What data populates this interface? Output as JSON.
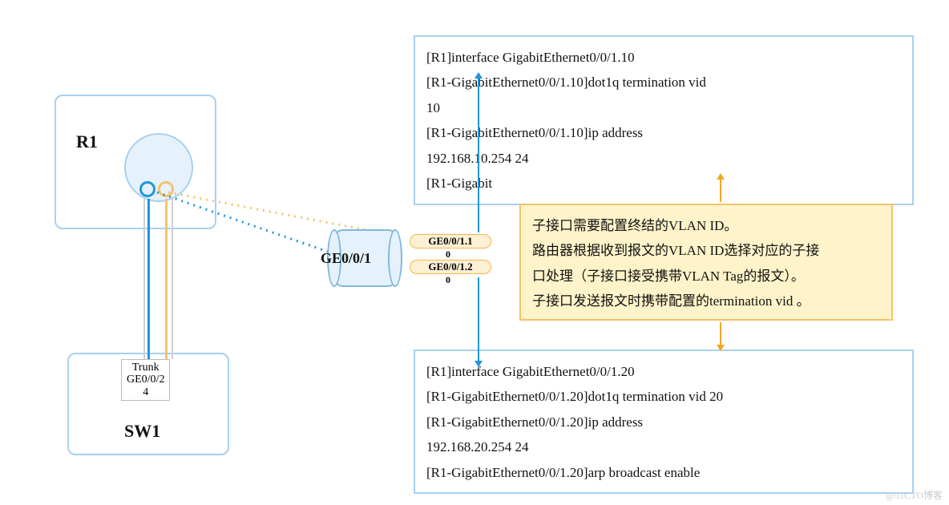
{
  "devices": {
    "r1": "R1",
    "sw1": "SW1"
  },
  "trunk": {
    "line1": "Trunk",
    "line2": "GE0/0/2",
    "line3": "4"
  },
  "cylinder_label": "GE0/0/1",
  "subif": {
    "a": "GE0/0/1.1",
    "a2": "0",
    "b": "GE0/0/1.2",
    "b2": "0"
  },
  "code_top": {
    "l1": "[R1]interface GigabitEthernet0/0/1.10",
    "l2": "[R1-GigabitEthernet0/0/1.10]dot1q termination vid",
    "l3": "10",
    "l4": "[R1-GigabitEthernet0/0/1.10]ip address",
    "l5": "192.168.10.254 24",
    "l6": "[R1-Gigabit"
  },
  "note": {
    "l1": "子接口需要配置终结的VLAN ID。",
    "l2": "路由器根据收到报文的VLAN ID选择对应的子接",
    "l3": "口处理（子接口接受携带VLAN Tag的报文）。",
    "l4": "子接口发送报文时携带配置的termination vid 。"
  },
  "code_bottom": {
    "l1": "[R1]interface GigabitEthernet0/0/1.20",
    "l2": "[R1-GigabitEthernet0/0/1.20]dot1q termination vid 20",
    "l3": "[R1-GigabitEthernet0/0/1.20]ip address",
    "l4": "192.168.20.254 24",
    "l5": "[R1-GigabitEthernet0/0/1.20]arp broadcast enable"
  },
  "watermark": "@51CTO博客"
}
